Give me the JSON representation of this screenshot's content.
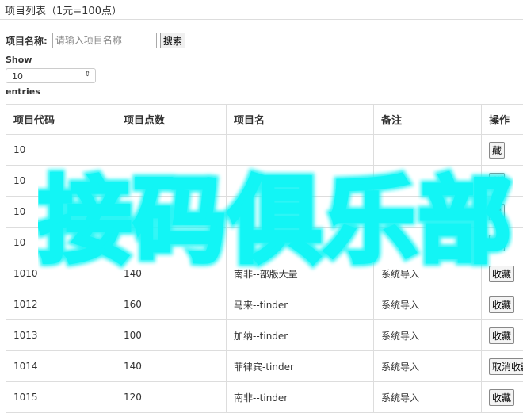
{
  "page": {
    "title": "项目列表（1元=100点）"
  },
  "search": {
    "label": "项目名称:",
    "placeholder": "请输入项目名称",
    "button": "搜索"
  },
  "paging": {
    "show_label": "Show",
    "page_size": "10",
    "entries_label": "entries"
  },
  "table": {
    "headers": [
      "项目代码",
      "项目点数",
      "项目名",
      "备注",
      "操作"
    ],
    "rows": [
      {
        "code": "10",
        "points": "",
        "name": "",
        "note": "",
        "action": "藏"
      },
      {
        "code": "10",
        "points": "",
        "name": "",
        "note": "",
        "action": "藏"
      },
      {
        "code": "10",
        "points": "",
        "name": "",
        "note": "",
        "action": "藏"
      },
      {
        "code": "10",
        "points": "",
        "name": "",
        "note": "",
        "action": "藏"
      },
      {
        "code": "1010",
        "points": "140",
        "name": "南非--部版大量",
        "note": "系统导入",
        "action": "收藏"
      },
      {
        "code": "1012",
        "points": "160",
        "name": "马来--tinder",
        "note": "系统导入",
        "action": "收藏"
      },
      {
        "code": "1013",
        "points": "100",
        "name": "加纳--tinder",
        "note": "系统导入",
        "action": "收藏"
      },
      {
        "code": "1014",
        "points": "140",
        "name": "菲律宾-tinder",
        "note": "系统导入",
        "action": "取消收藏"
      },
      {
        "code": "1015",
        "points": "120",
        "name": "南非--tinder",
        "note": "系统导入",
        "action": "收藏"
      }
    ]
  },
  "watermark": {
    "text": "接码俱乐部",
    "color": "#12f5f5"
  }
}
